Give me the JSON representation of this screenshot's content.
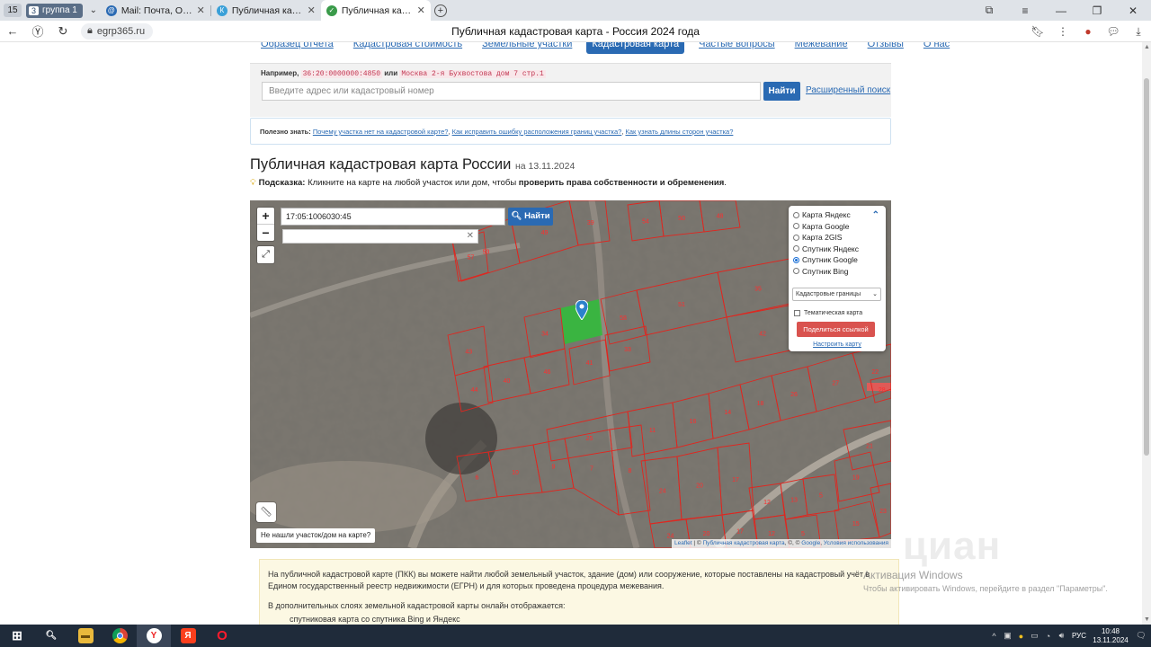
{
  "browser": {
    "tab_count": "15",
    "group": {
      "num": "3",
      "label": "группа 1"
    },
    "tabs": [
      {
        "label": "Mail: Почта, Облако, Календарь",
        "color": "#2a6ab3",
        "glyph": "@"
      },
      {
        "label": "Публичная кадастровая карта",
        "color": "#3aa0d8",
        "glyph": "К"
      },
      {
        "label": "Публичная кадастровая карта",
        "color": "#3a9b4a",
        "glyph": "✓",
        "active": true
      }
    ],
    "url": "egrp365.ru",
    "page_title": "Публичная кадастровая карта - Россия 2024 года"
  },
  "site_nav": {
    "items": [
      {
        "label": "Образец отчета"
      },
      {
        "label": "Кадастровая стоимость"
      },
      {
        "label": "Земельные участки"
      },
      {
        "label": "Кадастровая карта",
        "active": true
      },
      {
        "label": "Частые вопросы"
      },
      {
        "label": "Межевание"
      },
      {
        "label": "Отзывы"
      },
      {
        "label": "О нас"
      }
    ]
  },
  "search": {
    "example_prefix": "Например,",
    "example_code1": "36:20:0000000:4850",
    "example_or": "или",
    "example_code2": "Москва 2-я Бухвостова дом 7 стр.1",
    "placeholder": "Введите адрес или кадастровый номер",
    "button": "Найти",
    "advanced": "Расширенный поиск"
  },
  "info": {
    "prefix": "Полезно знать:",
    "links": [
      "Почему участка нет на кадастровой карте?",
      "Как исправить ошибку расположения границ участка?",
      "Как узнать длины сторон участка?"
    ]
  },
  "heading": {
    "title": "Публичная кадастровая карта России",
    "date": "на 13.11.2024"
  },
  "hint": {
    "label": "Подсказка:",
    "text": "Кликните на карте на любой участок или дом, чтобы",
    "bold": "проверить права собственности и обременения",
    "end": "."
  },
  "map": {
    "zoom_in": "+",
    "zoom_out": "−",
    "search_value": "17:05:1006030:45",
    "search_btn": "Найти",
    "not_found": "Не нашли участок/дом на карте?",
    "attribution": {
      "leaflet": "Leaflet",
      "sep1": " | © ",
      "pkk": "Публичная кадастровая карта",
      "sep2": ", ©, © ",
      "google": "Google",
      "sep3": ", ",
      "terms": "Условия использования"
    },
    "layers": {
      "options": [
        {
          "label": "Карта Яндекс",
          "checked": false
        },
        {
          "label": "Карта Google",
          "checked": false
        },
        {
          "label": "Карта 2GIS",
          "checked": false
        },
        {
          "label": "Спутник Яндекс",
          "checked": false
        },
        {
          "label": "Спутник Google",
          "checked": true
        },
        {
          "label": "Спутник Bing",
          "checked": false
        }
      ],
      "select_value": "Кадастровые границы",
      "thematic": "Тематическая карта",
      "share": "Поделиться ссылкой",
      "configure": "Настроить карту"
    },
    "parcel_labels": [
      "53",
      "49",
      "39",
      "54",
      "50",
      "48",
      "57",
      "58",
      "51",
      "35",
      "34",
      "43",
      "46",
      "41",
      "33",
      "42",
      "40",
      "44",
      "25",
      "11",
      "16",
      "14",
      "18",
      "26",
      "27",
      "22",
      "21",
      "6",
      "10",
      "9",
      "7",
      "8",
      "24",
      "20",
      "17",
      "12",
      "13",
      "5",
      "19",
      "15",
      "23",
      "24",
      "20",
      "17",
      "12",
      "5",
      "28"
    ]
  },
  "description": {
    "p1": "На публичной кадастровой карте (ПКК) вы можете найти любой земельный участок, здание (дом) или сооружение, которые поставлены на кадастровый учёт в Едином государственный реестр недвижимости (ЕГРН) и для которых проведена процедура межевания.",
    "p2": "В дополнительных слоях земельной кадастровой карты онлайн отображается:",
    "li1": "спутниковая карта со спутника Bing и Яндекс"
  },
  "watermark": {
    "logo": "циан",
    "title": "Активация Windows",
    "sub": "Чтобы активировать Windows, перейдите в раздел \"Параметры\"."
  },
  "taskbar": {
    "lang": "РУС",
    "time": "10:48",
    "date": "13.11.2024"
  }
}
